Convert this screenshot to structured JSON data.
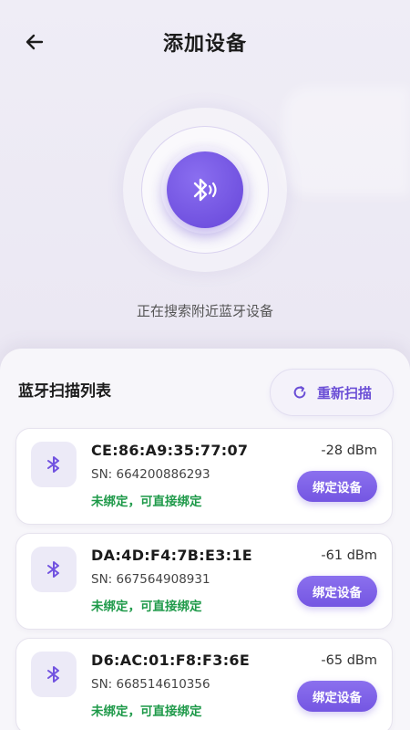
{
  "header": {
    "title": "添加设备"
  },
  "scan": {
    "status": "正在搜索附近蓝牙设备"
  },
  "list": {
    "title": "蓝牙扫描列表",
    "rescan_label": "重新扫描",
    "devices": [
      {
        "mac": "CE:86:A9:35:77:07",
        "sn": "SN: 664200886293",
        "state": "未绑定，可直接绑定",
        "rssi": "-28 dBm",
        "action": "绑定设备"
      },
      {
        "mac": "DA:4D:F4:7B:E3:1E",
        "sn": "SN: 667564908931",
        "state": "未绑定，可直接绑定",
        "rssi": "-61 dBm",
        "action": "绑定设备"
      },
      {
        "mac": "D6:AC:01:F8:F3:6E",
        "sn": "SN: 668514610356",
        "state": "未绑定，可直接绑定",
        "rssi": "-65 dBm",
        "action": "绑定设备"
      }
    ]
  },
  "icons": {
    "back": "arrow-left-icon",
    "radar": "bluetooth-searching-icon",
    "rescan": "refresh-icon",
    "device": "bluetooth-icon"
  },
  "colors": {
    "accent": "#7152e0",
    "success": "#1f9a4a",
    "background": "#efedf6"
  }
}
